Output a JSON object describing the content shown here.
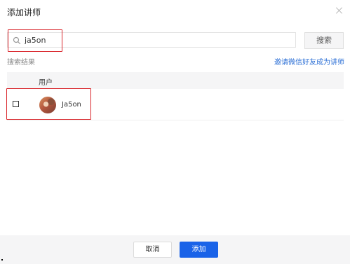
{
  "dialog": {
    "title": "添加讲师"
  },
  "search": {
    "value": "ja5on",
    "button_label": "搜索"
  },
  "results": {
    "label": "搜索结果",
    "invite_link": "邀请微信好友成为讲师",
    "column_header": "用户",
    "rows": [
      {
        "username": "Ja5on",
        "checked": false
      }
    ]
  },
  "footer": {
    "cancel_label": "取消",
    "add_label": "添加"
  },
  "colors": {
    "accent": "#1a63e8",
    "link": "#2b6fd6",
    "highlight": "#d9262c"
  }
}
